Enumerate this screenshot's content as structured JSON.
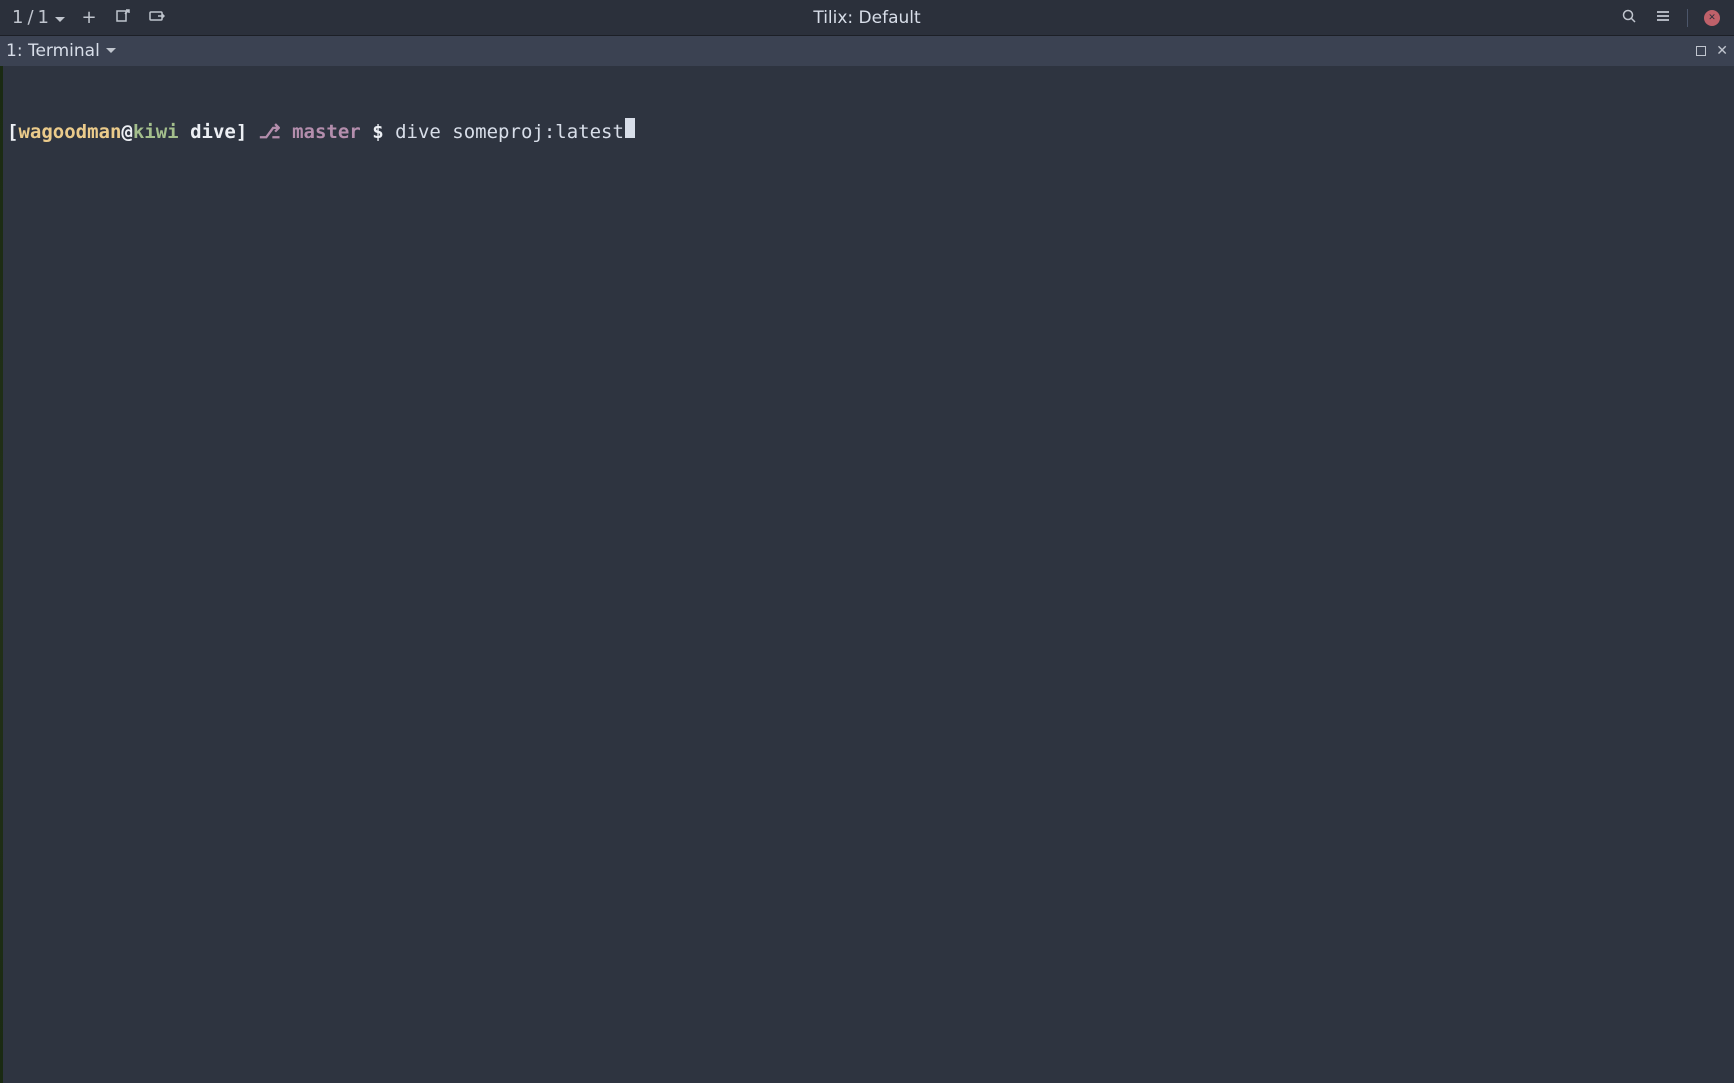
{
  "titlebar": {
    "session_current": "1",
    "session_separator": "/",
    "session_total": "1",
    "window_title": "Tilix: Default"
  },
  "icons": {
    "plus": "+",
    "new_window": "new-window-icon",
    "sync": "sync-input-icon",
    "search": "search-icon",
    "menu": "hamburger-menu-icon",
    "close": "close-icon",
    "maximize": "maximize-icon",
    "pane_close": "pane-close-icon"
  },
  "session": {
    "tab_label": "1: Terminal"
  },
  "prompt": {
    "lbracket": "[",
    "user": "wagoodman",
    "at": "@",
    "host": "kiwi",
    "space": " ",
    "dir": "dive",
    "rbracket": "]",
    "branch_glyph": "⎇",
    "branch": "master",
    "sigil": "$",
    "command": "dive someproj:latest"
  },
  "colors": {
    "bg": "#2e3440",
    "bar": "#2b303b",
    "tab": "#3b4252",
    "fg": "#d8dee9",
    "yellow": "#ebcb8b",
    "green": "#a3be8c",
    "purple": "#b48ead",
    "close": "#bf616a"
  }
}
